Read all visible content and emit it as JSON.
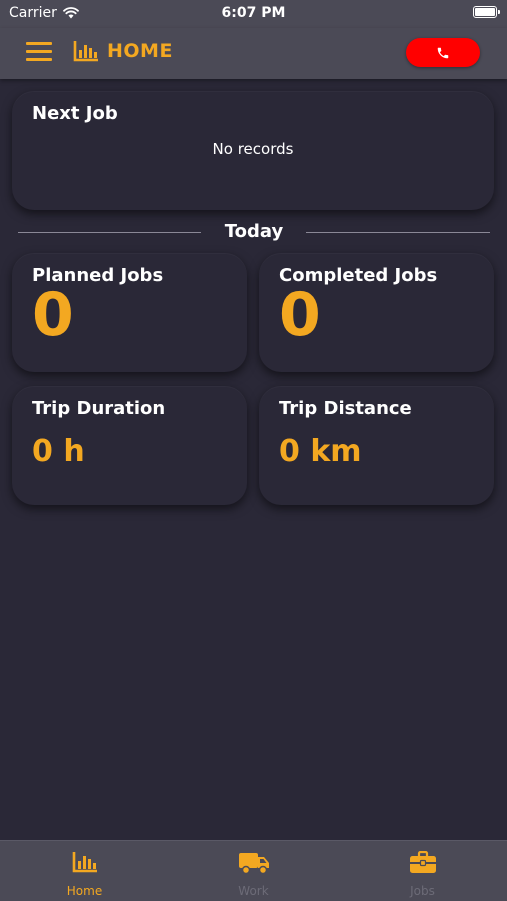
{
  "status_bar": {
    "carrier": "Carrier",
    "time": "6:07 PM"
  },
  "header": {
    "title": "HOME"
  },
  "next_job": {
    "title": "Next Job",
    "empty_text": "No records"
  },
  "today": {
    "label": "Today",
    "planned_jobs": {
      "label": "Planned Jobs",
      "value": "0"
    },
    "completed_jobs": {
      "label": "Completed Jobs",
      "value": "0"
    },
    "trip_duration": {
      "label": "Trip Duration",
      "value": "0 h"
    },
    "trip_distance": {
      "label": "Trip Distance",
      "value": "0 km"
    }
  },
  "tabs": [
    {
      "label": "Home",
      "icon": "chart-icon",
      "active": true
    },
    {
      "label": "Work",
      "icon": "truck-icon",
      "active": false
    },
    {
      "label": "Jobs",
      "icon": "briefcase-icon",
      "active": false
    }
  ],
  "colors": {
    "accent": "#f3a821",
    "background": "#2a2837",
    "bar": "#4b4a56",
    "call": "#ff0000"
  }
}
